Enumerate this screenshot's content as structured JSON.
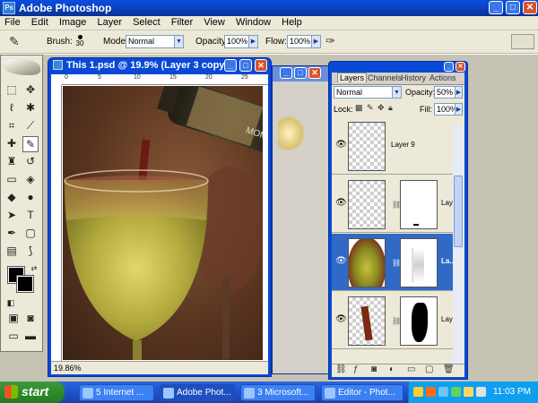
{
  "window": {
    "title": "Adobe Photoshop"
  },
  "menu": [
    "File",
    "Edit",
    "Image",
    "Layer",
    "Select",
    "Filter",
    "View",
    "Window",
    "Help"
  ],
  "options": {
    "brush_label": "Brush:",
    "brush_size": "30",
    "mode_label": "Mode:",
    "mode_value": "Normal",
    "opacity_label": "Opacity:",
    "opacity_value": "100%",
    "flow_label": "Flow:",
    "flow_value": "100%"
  },
  "document": {
    "title": "This 1.psd @ 19.9% (Layer 3 copy, ...",
    "zoom": "19.86%",
    "ruler_ticks": [
      "0",
      "5",
      "10",
      "15",
      "20",
      "25"
    ],
    "bottle_label": "MOMM"
  },
  "layers_panel": {
    "tabs": [
      "Layers",
      "Channels",
      "History",
      "Actions"
    ],
    "blend_mode": "Normal",
    "opacity_label": "Opacity:",
    "opacity_value": "50%",
    "lock_label": "Lock:",
    "fill_label": "Fill:",
    "fill_value": "100%",
    "layers": [
      {
        "name": "Layer 9",
        "selected": false
      },
      {
        "name": "Lay...",
        "selected": false
      },
      {
        "name": "La...",
        "selected": true
      },
      {
        "name": "Lay...",
        "selected": false
      }
    ]
  },
  "taskbar": {
    "start": "start",
    "tasks": [
      "5 Internet ...",
      "Adobe Phot...",
      "3 Microsoft...",
      "Editor - Phot..."
    ],
    "clock": "11:03 PM"
  },
  "icons": {
    "close": "close-icon",
    "minimize": "minimize-icon",
    "maximize": "maximize-icon",
    "eye": "eye-icon"
  },
  "colors": {
    "xp_blue": "#0a49d6",
    "selection": "#316ac5",
    "start_green": "#2d8b2d"
  }
}
